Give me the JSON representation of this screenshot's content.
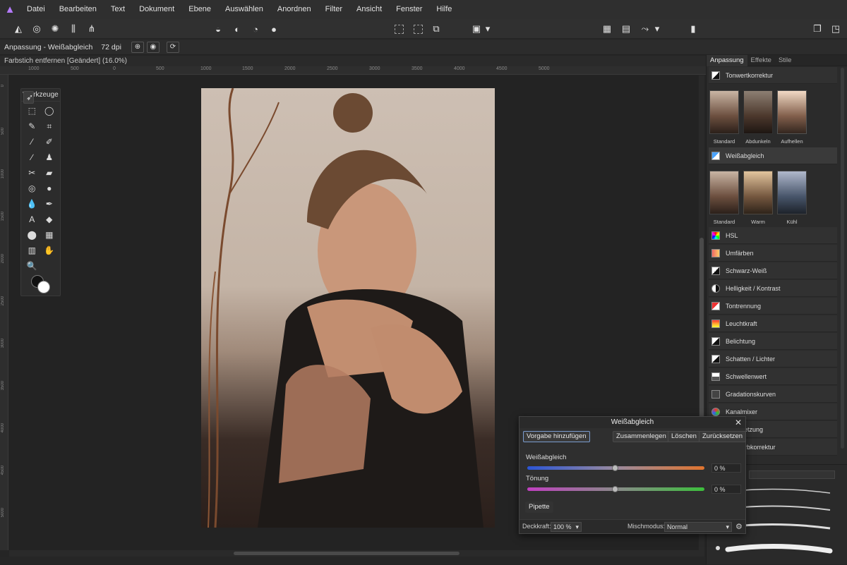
{
  "menu": {
    "items": [
      "Datei",
      "Bearbeiten",
      "Text",
      "Dokument",
      "Ebene",
      "Auswählen",
      "Anordnen",
      "Filter",
      "Ansicht",
      "Fenster",
      "Hilfe"
    ]
  },
  "context": {
    "title": "Anpassung - Weißabgleich",
    "dpi": "72 dpi"
  },
  "document": {
    "tab": "Farbstich entfernen [Geändert] (16.0%)"
  },
  "ruler": {
    "top": [
      "1000",
      "500",
      "0",
      "500",
      "1000",
      "1500",
      "2000",
      "2500",
      "3000",
      "3500",
      "4000",
      "4500",
      "5000"
    ],
    "left": [
      "0",
      "500",
      "1000",
      "1500",
      "2000",
      "2500",
      "3000",
      "3500",
      "4000",
      "4500",
      "5000"
    ]
  },
  "tools": {
    "title": "Werkzeuge"
  },
  "panel": {
    "tabs": [
      "Anpassung",
      "Effekte",
      "Stile"
    ],
    "tonwert": "Tonwertkorrektur",
    "tonwert_presets": [
      "Standard",
      "Abdunkeln",
      "Aufhellen"
    ],
    "weiss": "Weißabgleich",
    "weiss_presets": [
      "Standard",
      "Warm",
      "Kühl"
    ],
    "items": [
      "HSL",
      "Umfärben",
      "Schwarz-Weiß",
      "Helligkeit / Kontrast",
      "Tontrennung",
      "Leuchtkraft",
      "Belichtung",
      "Schatten / Lichter",
      "Schwellenwert",
      "Gradationskurven",
      "Kanalmixer",
      "…umsetzung",
      "…e Farbkorrektur"
    ]
  },
  "dialog": {
    "title": "Weißabgleich",
    "buttons": {
      "add_preset": "Vorgabe hinzufügen",
      "merge": "Zusammenlegen",
      "delete": "Löschen",
      "reset": "Zurücksetzen"
    },
    "sliders": {
      "white_balance_label": "Weißabgleich",
      "white_balance_value": "0 %",
      "tint_label": "Tönung",
      "tint_value": "0 %"
    },
    "pipette": "Pipette",
    "opacity_label": "Deckkraft:",
    "opacity_value": "100 %",
    "blend_label": "Mischmodus:",
    "blend_value": "Normal"
  }
}
